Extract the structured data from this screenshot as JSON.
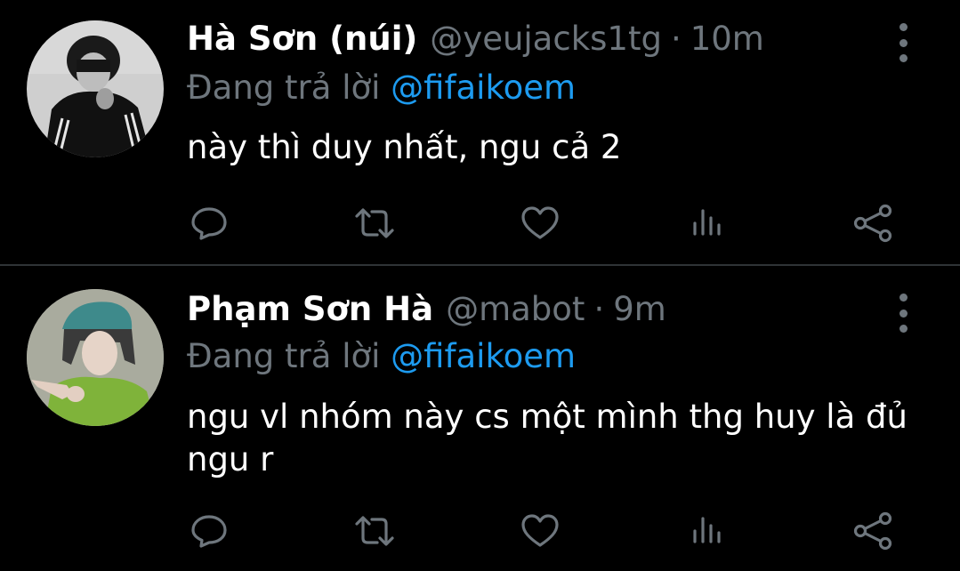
{
  "tweets": [
    {
      "name": "Hà Sơn (núi)",
      "handle": "@yeujacks1tg",
      "separator": "·",
      "time": "10m",
      "replying_prefix": "Đang trả lời",
      "replying_to": "@fifaikoem",
      "text": "này thì duy nhất, ngu cả 2"
    },
    {
      "name": "Phạm Sơn Hà",
      "handle": "@mabot",
      "separator": "·",
      "time": "9m",
      "replying_prefix": "Đang trả lời",
      "replying_to": "@fifaikoem",
      "text": "ngu vl nhóm này cs một mình thg huy là đủ ngu r"
    }
  ],
  "action_icons": [
    "reply-icon",
    "retweet-icon",
    "like-icon",
    "views-icon",
    "share-icon"
  ],
  "colors": {
    "background": "#000000",
    "primary_text": "#ffffff",
    "secondary_text": "#6e767d",
    "mention": "#1d9bf0",
    "divider": "#2f3336"
  }
}
